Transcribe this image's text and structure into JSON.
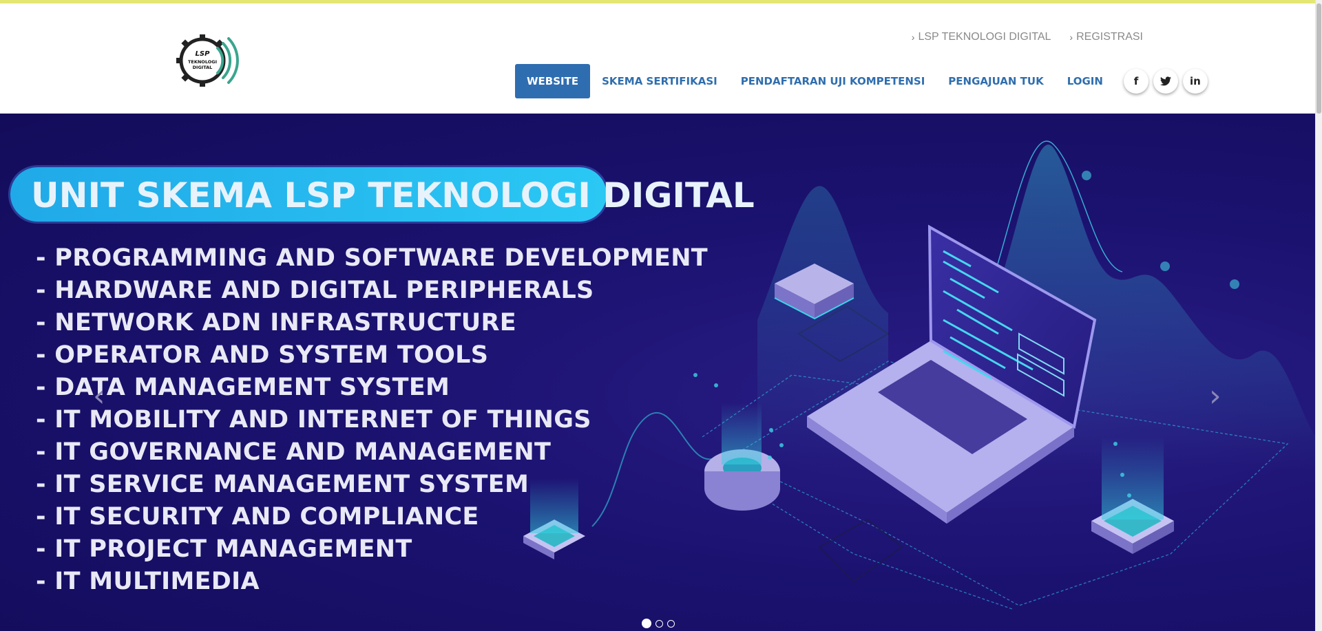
{
  "logo": {
    "text_top": "LSP",
    "text_mid": "TEKNOLOGI",
    "text_bot": "DIGITAL"
  },
  "top_nav": [
    {
      "label": "LSP TEKNOLOGI DIGITAL"
    },
    {
      "label": "REGISTRASI"
    }
  ],
  "main_nav": [
    {
      "label": "WEBSITE",
      "active": true
    },
    {
      "label": "SKEMA SERTIFIKASI"
    },
    {
      "label": "PENDAFTARAN UJI KOMPETENSI"
    },
    {
      "label": "PENGAJUAN TUK"
    },
    {
      "label": "LOGIN"
    }
  ],
  "social": [
    {
      "icon": "facebook-icon",
      "glyph": "f"
    },
    {
      "icon": "twitter-icon",
      "glyph": "🐦"
    },
    {
      "icon": "linkedin-icon",
      "glyph": "in"
    }
  ],
  "hero": {
    "title": "UNIT SKEMA LSP TEKNOLOGI DIGITAL",
    "items": [
      "- PROGRAMMING AND SOFTWARE DEVELOPMENT",
      "- HARDWARE AND DIGITAL PERIPHERALS",
      "- NETWORK ADN INFRASTRUCTURE",
      "- OPERATOR AND SYSTEM TOOLS",
      "- DATA MANAGEMENT SYSTEM",
      "- IT MOBILITY AND INTERNET OF THINGS",
      "- IT GOVERNANCE AND MANAGEMENT",
      "- IT SERVICE MANAGEMENT SYSTEM",
      "- IT SECURITY AND COMPLIANCE",
      "- IT PROJECT MANAGEMENT",
      "- IT MULTIMEDIA"
    ],
    "prev_glyph": "‹",
    "next_glyph": "›",
    "slide_count": 3,
    "active_slide": 1
  },
  "colors": {
    "accent": "#2f6db1",
    "hero_bg": "#1b1270",
    "badge": "#20a9e8",
    "topline": "#e4e774"
  }
}
